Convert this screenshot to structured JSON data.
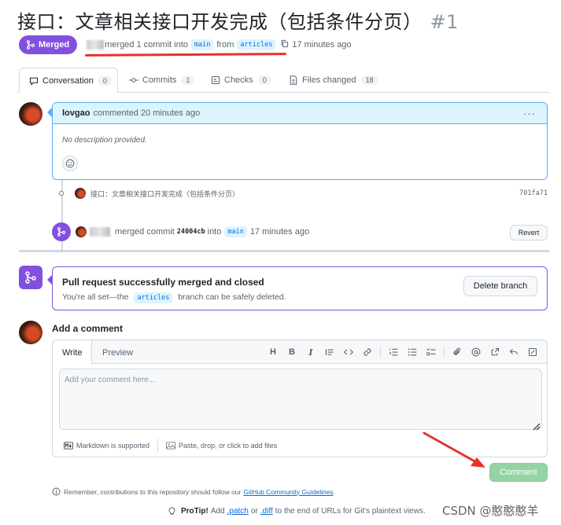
{
  "pr": {
    "title": "接口：文章相关接口开发完成（包括条件分页）",
    "number": "#1",
    "status_label": "Merged",
    "meta_text": "merged 1 commit into",
    "base_branch": "main",
    "from_text": "from",
    "head_branch": "articles",
    "time": "17 minutes ago"
  },
  "tabs": [
    {
      "label": "Conversation",
      "count": "0"
    },
    {
      "label": "Commits",
      "count": "1"
    },
    {
      "label": "Checks",
      "count": "0"
    },
    {
      "label": "Files changed",
      "count": "18"
    }
  ],
  "comment": {
    "author": "lovgao",
    "action": "commented 20 minutes ago",
    "body": "No description provided."
  },
  "commit_event": {
    "message": "接口：文章相关接口开发完成（包括条件分页）",
    "sha": "701fa71"
  },
  "merge_event": {
    "text1": "merged commit",
    "sha": "24004cb",
    "text2": "into",
    "branch": "main",
    "time": "17 minutes ago",
    "revert_label": "Revert"
  },
  "merged_box": {
    "heading": "Pull request successfully merged and closed",
    "sub1": "You're all set—the",
    "branch": "articles",
    "sub2": "branch can be safely deleted.",
    "delete_label": "Delete branch"
  },
  "add_comment": {
    "title": "Add a comment",
    "write_tab": "Write",
    "preview_tab": "Preview",
    "placeholder": "Add your comment here...",
    "markdown_note": "Markdown is supported",
    "attach_note": "Paste, drop, or click to add files",
    "submit_label": "Comment"
  },
  "footer": {
    "remember_text": "Remember, contributions to this repository should follow our",
    "guidelines_link": "GitHub Community Guidelines",
    "protip_label": "ProTip!",
    "protip_add": "Add",
    "patch": ".patch",
    "or": "or",
    "diff": ".diff",
    "protip_rest": "to the end of URLs for Git's plaintext views.",
    "watermark": "CSDN @憨憨憨羊"
  },
  "colors": {
    "merged": "#8250df",
    "link": "#0969da",
    "annotation_red": "#e5332a",
    "comment_btn": "#94d3a2"
  }
}
